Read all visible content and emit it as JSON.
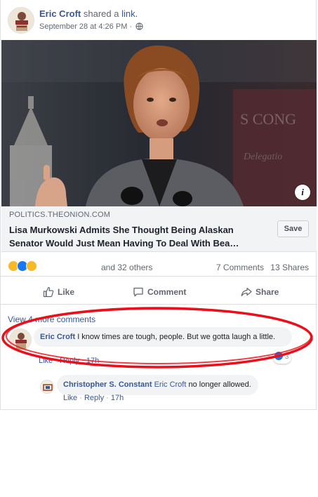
{
  "post": {
    "author": "Eric Croft",
    "action_text": "shared a",
    "action_link": "link.",
    "timestamp": "September 28 at 4:26 PM ·",
    "privacy_icon": "globe-icon"
  },
  "link_preview": {
    "domain": "POLITICS.THEONION.COM",
    "title": "Lisa Murkowski Admits She Thought Being Alaskan Senator Would Just Mean Having To Deal With Bea…",
    "save_label": "Save",
    "info_label": "i"
  },
  "stats": {
    "reaction_icons": [
      "haha-icon",
      "like-icon",
      "wow-icon"
    ],
    "others_text": "and 32 others",
    "comments_text": "7 Comments",
    "shares_text": "13 Shares"
  },
  "actions": {
    "like": "Like",
    "comment": "Comment",
    "share": "Share"
  },
  "comments": {
    "view_more": "View 4 more comments",
    "items": [
      {
        "author": "Eric Croft",
        "text": "I know times are tough, people. But we gotta laugh a little.",
        "like": "Like",
        "reply": "Reply",
        "time": "17h",
        "reaction_count": "3"
      },
      {
        "author": "Christopher S. Constant",
        "mention": "Eric Croft",
        "text": "no longer allowed.",
        "like": "Like",
        "reply": "Reply",
        "time": "17h"
      }
    ]
  },
  "colors": {
    "link_blue": "#385898",
    "annotation_red": "#e8101a",
    "like_blue": "#1877f2",
    "haha_yellow": "#f7b928"
  }
}
